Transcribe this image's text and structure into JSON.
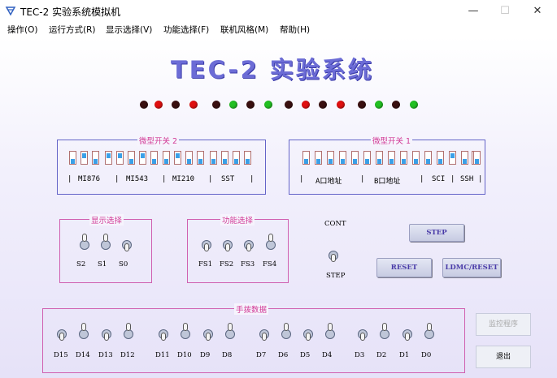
{
  "window": {
    "title": "TEC-2 实验系统模拟机",
    "minimize": "—",
    "maximize": "☐",
    "close": "✕"
  },
  "menu": [
    "操作(O)",
    "运行方式(R)",
    "显示选择(V)",
    "功能选择(F)",
    "联机风格(M)",
    "帮助(H)"
  ],
  "main_title": "TEC-2 实验系统",
  "leds": [
    "dark",
    "red",
    "dark",
    "red",
    "dark",
    "green",
    "dark",
    "green",
    "dark",
    "red",
    "dark",
    "red",
    "dark",
    "green",
    "dark",
    "green"
  ],
  "colors": {
    "led_red": "#e01010",
    "led_green": "#22c022",
    "led_dark": "#3a1010",
    "legend": "#d23a96",
    "dip_knob": "#3aa0e8"
  },
  "micro2": {
    "legend": "微型开关 2",
    "segments": [
      "MI876",
      "MI543",
      "MI210",
      "SST"
    ],
    "switches": [
      "down",
      "up",
      "down",
      "up",
      "up",
      "down",
      "up",
      "down",
      "down",
      "up",
      "down",
      "down",
      "down",
      "down",
      "down",
      "down"
    ]
  },
  "micro1": {
    "legend": "微型开关 1",
    "segments": [
      "A口地址",
      "B口地址",
      "SCI",
      "SSH"
    ],
    "switches": [
      "down",
      "down",
      "down",
      "down",
      "down",
      "down",
      "down",
      "down",
      "down",
      "down",
      "down",
      "down",
      "up",
      "down",
      "up",
      "down"
    ]
  },
  "display_select": {
    "legend": "显示选择",
    "switches": [
      {
        "label": "S2",
        "state": "up"
      },
      {
        "label": "S1",
        "state": "up"
      },
      {
        "label": "S0",
        "state": "down"
      }
    ]
  },
  "func_select": {
    "legend": "功能选择",
    "switches": [
      {
        "label": "FS1",
        "state": "down"
      },
      {
        "label": "FS2",
        "state": "down"
      },
      {
        "label": "FS3",
        "state": "down"
      },
      {
        "label": "FS4",
        "state": "up"
      }
    ]
  },
  "cont_step": {
    "top": "CONT",
    "bottom": "STEP"
  },
  "buttons": {
    "step": "STEP",
    "reset": "RESET",
    "ldmc": "LDMC/RESET",
    "monitor": "监控程序",
    "exit": "退出"
  },
  "manual_data": {
    "legend": "手拨数据",
    "switches": [
      {
        "label": "D15",
        "state": "down"
      },
      {
        "label": "D14",
        "state": "up"
      },
      {
        "label": "D13",
        "state": "down"
      },
      {
        "label": "D12",
        "state": "up"
      },
      {
        "label": "D11",
        "state": "down"
      },
      {
        "label": "D10",
        "state": "up"
      },
      {
        "label": "D9",
        "state": "down"
      },
      {
        "label": "D8",
        "state": "up"
      },
      {
        "label": "D7",
        "state": "down"
      },
      {
        "label": "D6",
        "state": "up"
      },
      {
        "label": "D5",
        "state": "down"
      },
      {
        "label": "D4",
        "state": "up"
      },
      {
        "label": "D3",
        "state": "down"
      },
      {
        "label": "D2",
        "state": "up"
      },
      {
        "label": "D1",
        "state": "down"
      },
      {
        "label": "D0",
        "state": "up"
      }
    ]
  }
}
